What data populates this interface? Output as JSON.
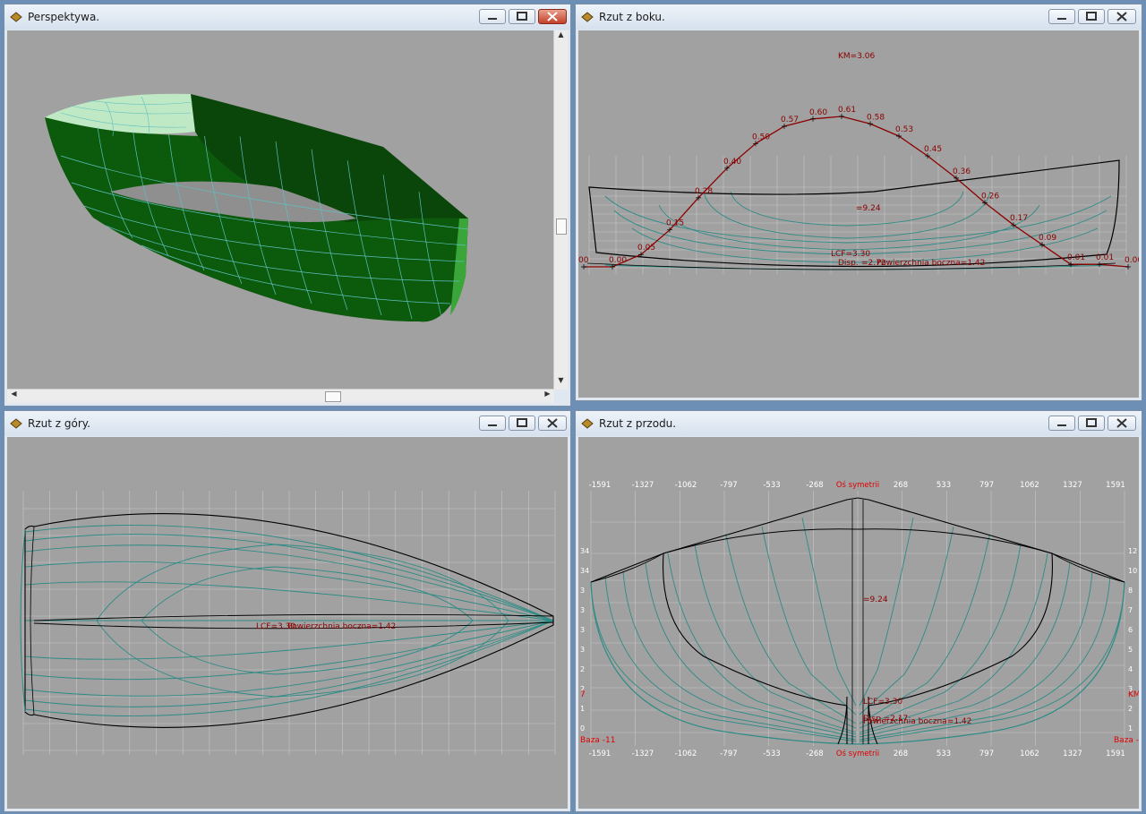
{
  "windows": {
    "perspective": {
      "title": "Perspektywa."
    },
    "side": {
      "title": "Rzut z boku."
    },
    "top": {
      "title": "Rzut z góry."
    },
    "front": {
      "title": "Rzut z przodu."
    }
  },
  "side_view": {
    "km_label": "KM=3.06",
    "kb_label": "=9.24",
    "lcf_label": "LCF=3.30",
    "displacement_label": "Disp.",
    "lateral_area_label": "Powierzchnia boczna=1.42",
    "overlap_label": "=2.72",
    "curve_values": [
      "00",
      "0.00",
      "0.05",
      "0.15",
      "0.28",
      "0.40",
      "0.50",
      "0.57",
      "0.60",
      "0.61",
      "0.58",
      "0.53",
      "0.45",
      "0.36",
      "0.26",
      "0.17",
      "0.09",
      "0.01",
      "0.01",
      "0.00"
    ]
  },
  "top_view": {
    "center_label": "LCF=3.30",
    "lateral_area_label": "Powierzchnia boczna=1.42"
  },
  "front_view": {
    "ticks": [
      "-1591",
      "-1327",
      "-1062",
      "-797",
      "-533",
      "-268",
      "Oś symetrii",
      "268",
      "533",
      "797",
      "1062",
      "1327",
      "1591"
    ],
    "kb_label": "=9.24",
    "lcf_label": "LCF=3.30",
    "area_label": "Powierzchnia boczna=1.42",
    "overlap_label": "Disp.=2.17",
    "base_left": "Baza -11",
    "base_right": "Baza -",
    "left_edge": [
      "34",
      "34",
      "3",
      "3",
      "3",
      "3",
      "2",
      "2",
      "1",
      "0"
    ],
    "right_edge": [
      "12",
      "10",
      "8",
      "7",
      "6",
      "5",
      "4",
      "3",
      "2",
      "1"
    ],
    "left_red": "7",
    "right_red": "KM"
  },
  "colors": {
    "hull_green": "#0f5c0f",
    "deck": "#b8e6bf",
    "grid": "#5fc0c0",
    "curve": "#8b0000",
    "line": "#000000"
  }
}
